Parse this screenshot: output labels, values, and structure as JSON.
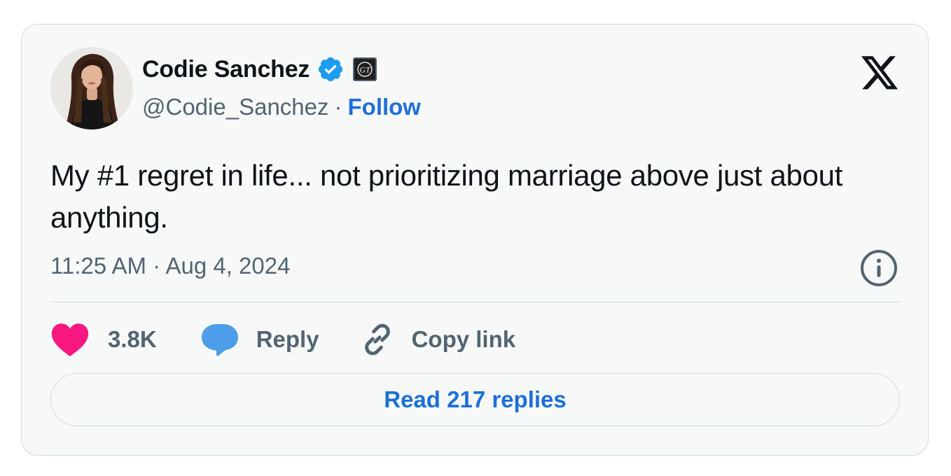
{
  "author": {
    "name": "Codie Sanchez",
    "handle": "@Codie_Sanchez",
    "separator": "·",
    "follow_label": "Follow",
    "verified_icon": "verified-badge-icon",
    "affiliation_icon": "affiliate-badge-icon"
  },
  "tweet": {
    "text": "My #1 regret in life... not prioritizing marriage above just about anything.",
    "timestamp": "11:25 AM · Aug 4, 2024"
  },
  "actions": {
    "like_count": "3.8K",
    "reply_label": "Reply",
    "copy_label": "Copy link"
  },
  "read_replies_label": "Read 217 replies",
  "colors": {
    "accent": "#1d6fd6",
    "verified": "#1d9bf0",
    "like": "#f91880",
    "reply_icon": "#4c9ee8",
    "secondary_text": "#536471",
    "primary_text": "#0f1419",
    "card_background": "#f7f9f9",
    "border": "#cfd9de"
  }
}
